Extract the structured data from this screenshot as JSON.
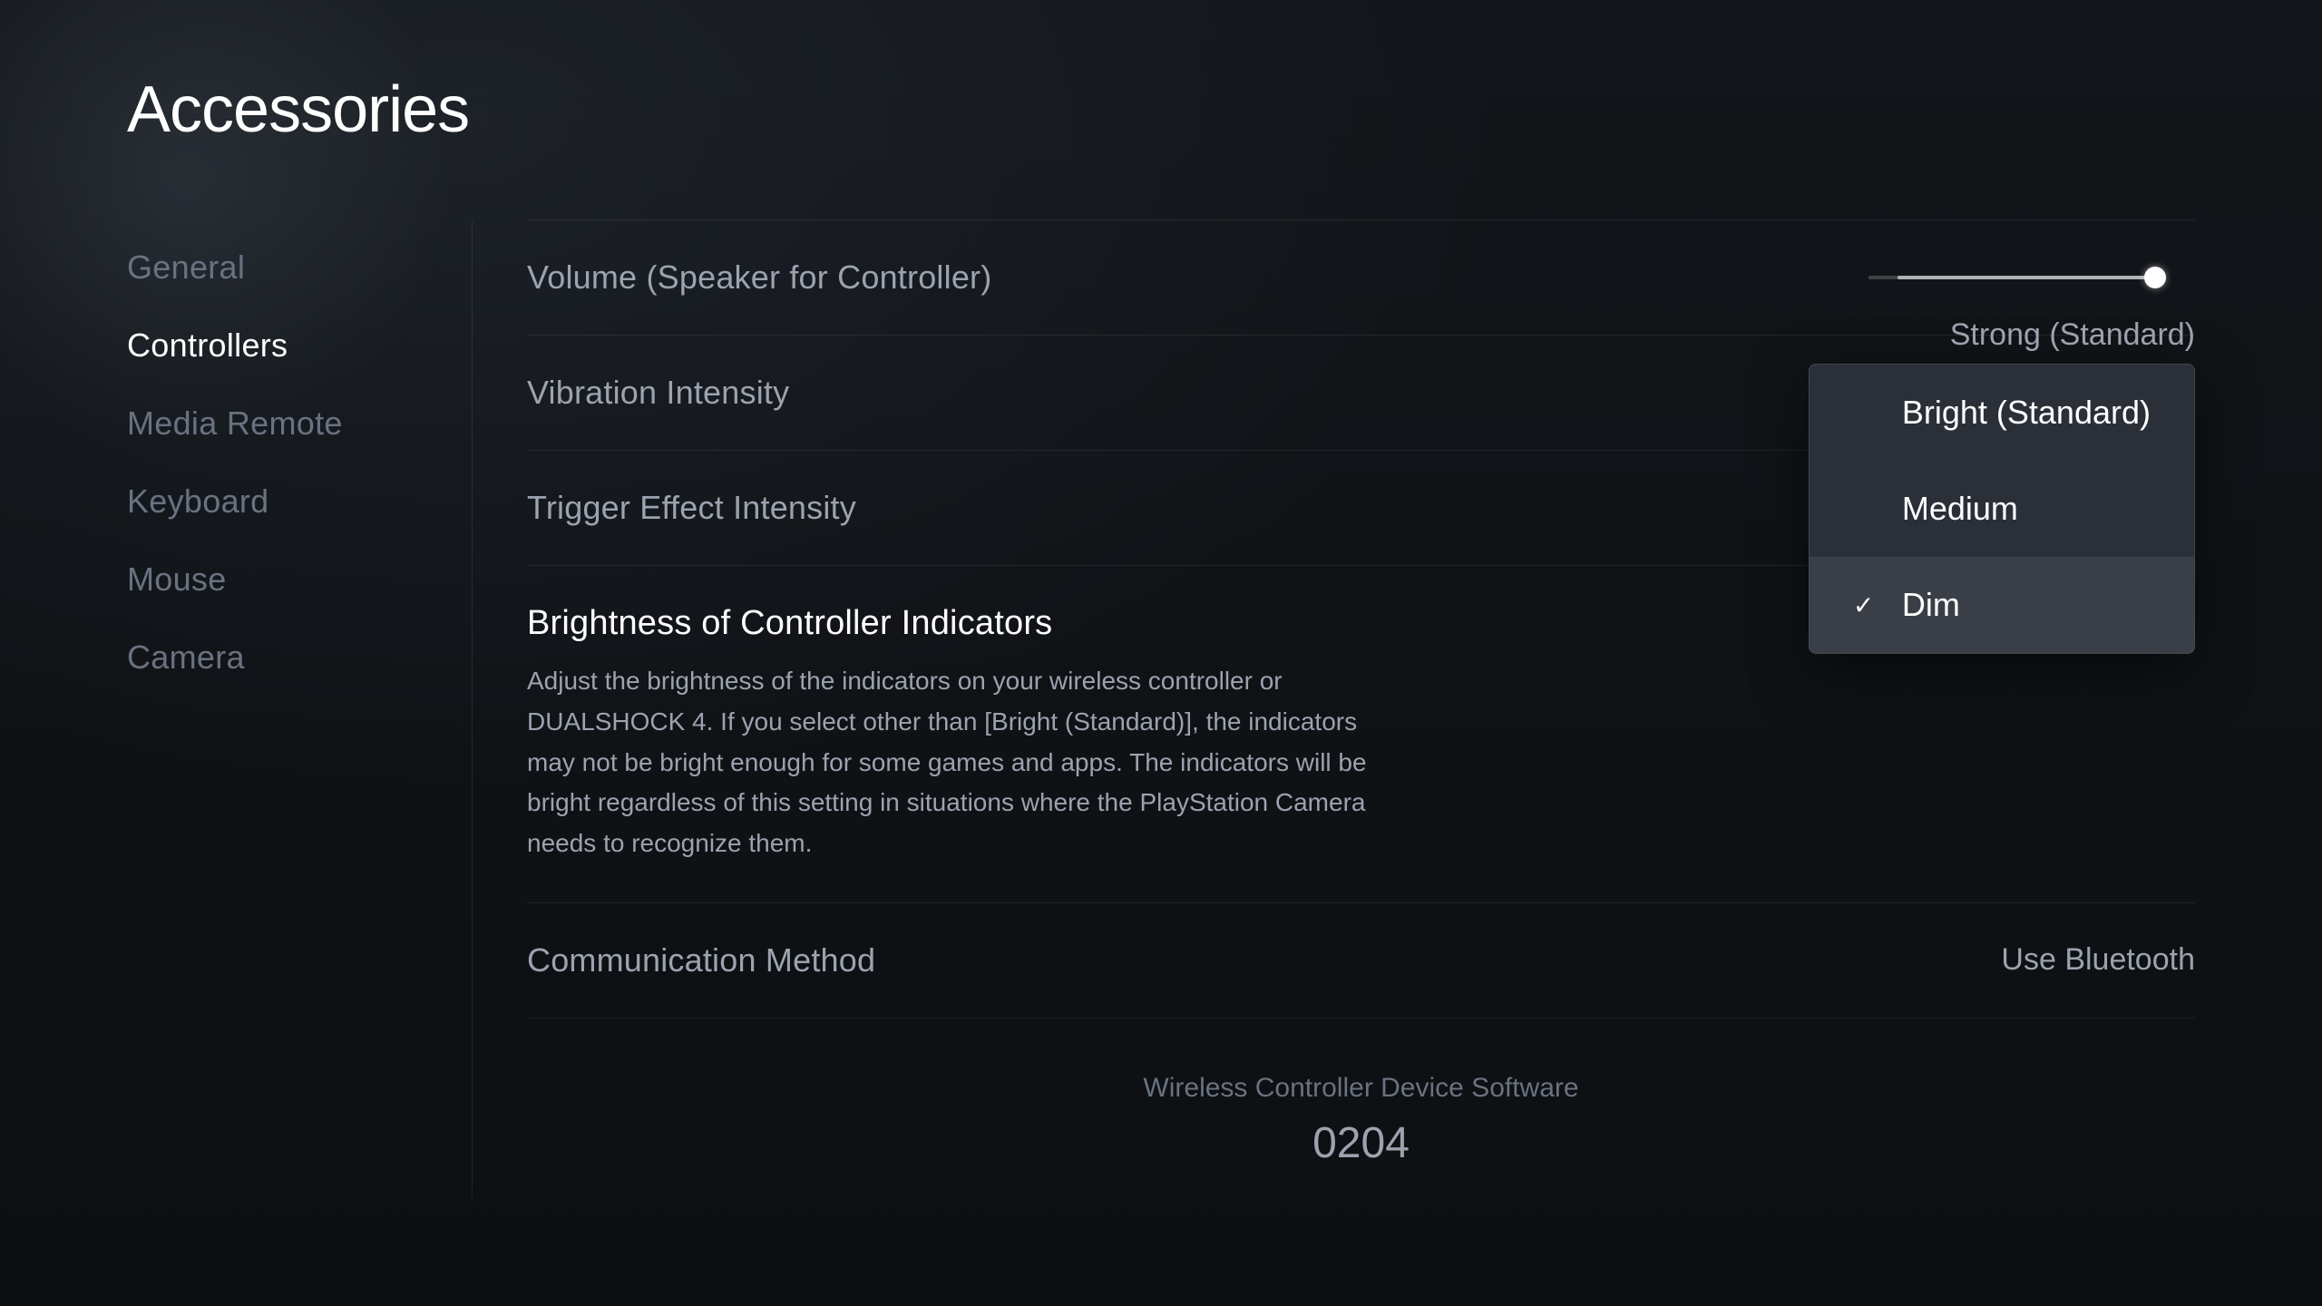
{
  "page": {
    "title": "Accessories"
  },
  "sidebar": {
    "items": [
      {
        "id": "general",
        "label": "General",
        "active": false
      },
      {
        "id": "controllers",
        "label": "Controllers",
        "active": true
      },
      {
        "id": "media-remote",
        "label": "Media Remote",
        "active": false
      },
      {
        "id": "keyboard",
        "label": "Keyboard",
        "active": false
      },
      {
        "id": "mouse",
        "label": "Mouse",
        "active": false
      },
      {
        "id": "camera",
        "label": "Camera",
        "active": false
      }
    ]
  },
  "settings": {
    "volume": {
      "label": "Volume (Speaker for Controller)",
      "slider_value": 90
    },
    "vibration": {
      "label": "Vibration Intensity",
      "current_value": "Strong (Standard)"
    },
    "trigger": {
      "label": "Trigger Effect Intensity"
    },
    "brightness": {
      "label": "Brightness of Controller Indicators",
      "description": "Adjust the brightness of the indicators on your wireless controller or DUALSHOCK 4. If you select other than [Bright (Standard)], the indicators may not be bright enough for some games and apps. The indicators will be bright regardless of this setting in situations where the PlayStation Camera needs to recognize them.",
      "current_value": "Dim",
      "options": [
        {
          "id": "bright",
          "label": "Bright (Standard)",
          "selected": false
        },
        {
          "id": "medium",
          "label": "Medium",
          "selected": false
        },
        {
          "id": "dim",
          "label": "Dim",
          "selected": true
        }
      ]
    },
    "communication": {
      "label": "Communication Method",
      "value": "Use Bluetooth"
    }
  },
  "device_software": {
    "label": "Wireless Controller Device Software",
    "version": "0204"
  },
  "icons": {
    "checkmark": "✓"
  }
}
